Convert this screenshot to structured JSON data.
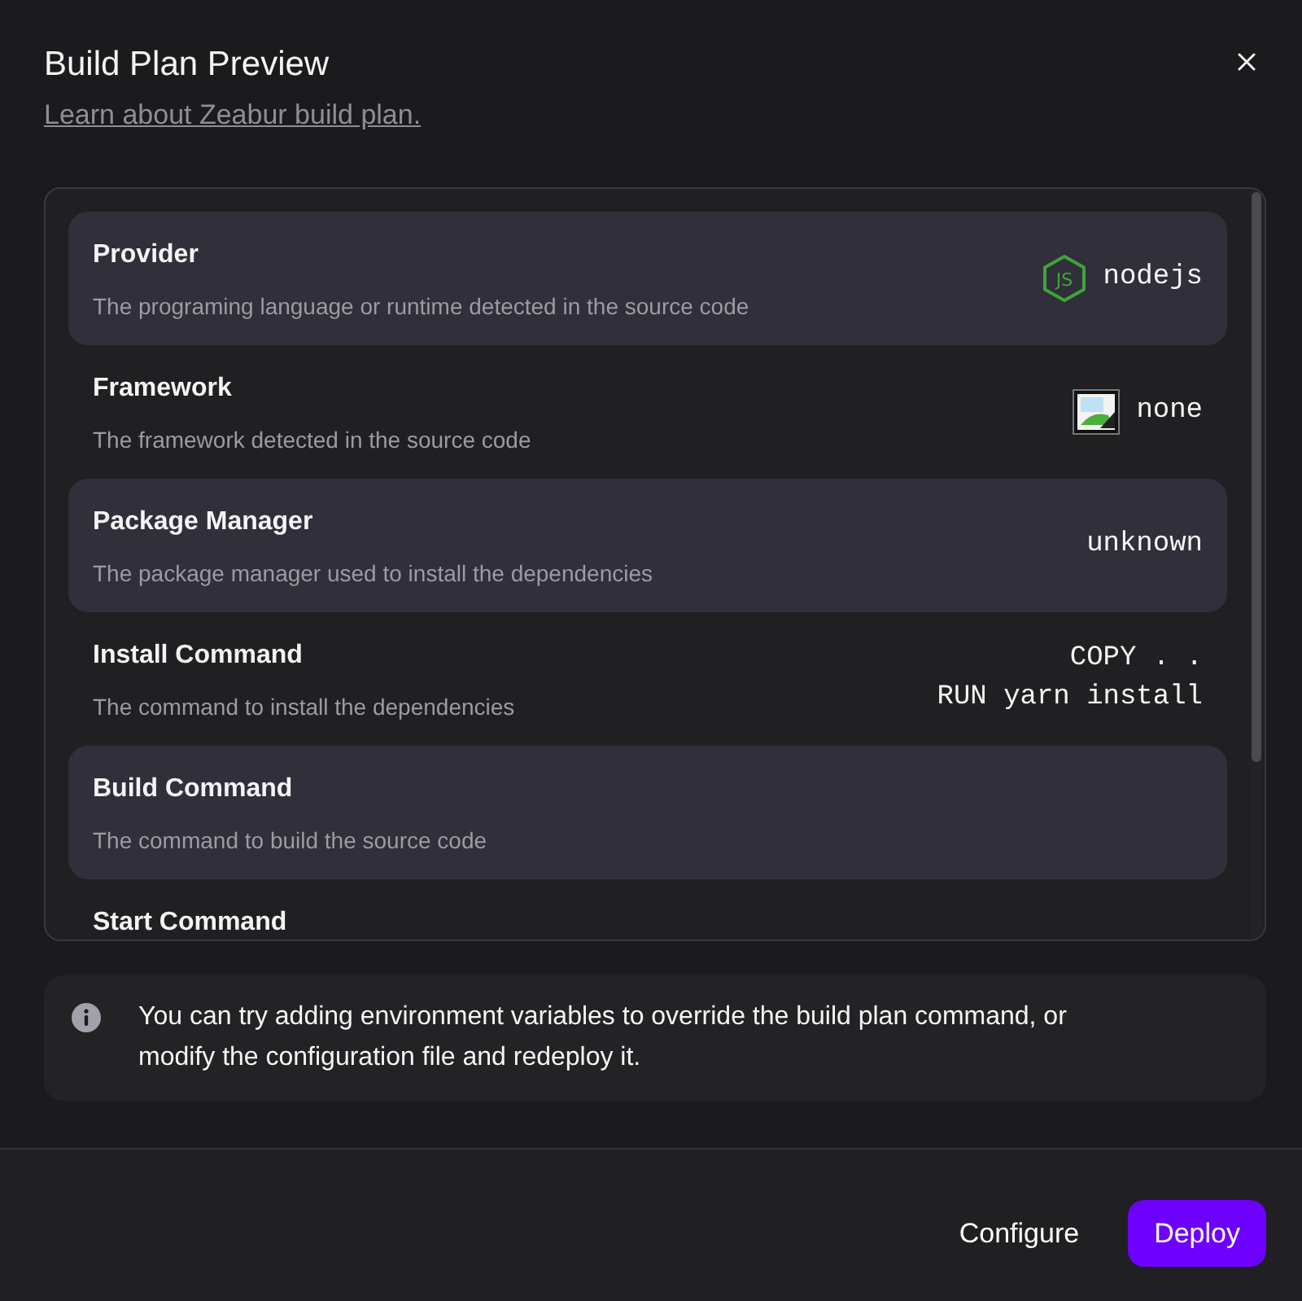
{
  "dialog": {
    "title": "Build Plan Preview",
    "link": "Learn about Zeabur build plan."
  },
  "plan": {
    "rows": [
      {
        "kind": "logo",
        "title": "Provider",
        "description": "The programing language or runtime detected in the source code",
        "logo_text": "JS",
        "value_lines": [
          "nodejs"
        ]
      },
      {
        "kind": "image",
        "title": "Framework",
        "description": "The framework detected in the source code",
        "value_lines": [
          "none"
        ]
      },
      {
        "kind": "plain",
        "title": "Package Manager",
        "description": "The package manager used to install the dependencies",
        "value_lines": [
          "unknown"
        ]
      },
      {
        "kind": "plain",
        "title": "Install Command",
        "description": "The command to install the dependencies",
        "value_lines": [
          "COPY . .",
          "RUN yarn install"
        ]
      },
      {
        "kind": "plain",
        "title": "Build Command",
        "description": "The command to build the source code"
      },
      {
        "kind": "plain",
        "title": "Start Command"
      }
    ]
  },
  "notice": {
    "text": "You can try adding environment variables to override the build plan command, or modify the configuration file and redeploy it."
  },
  "footer": {
    "buttons": [
      {
        "kind": "secondary",
        "label": "Configure"
      },
      {
        "kind": "primary",
        "label": "Deploy"
      }
    ]
  }
}
